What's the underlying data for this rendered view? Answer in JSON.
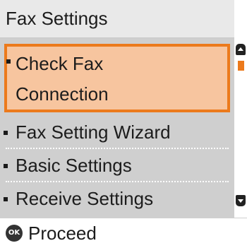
{
  "header": {
    "title": "Fax Settings"
  },
  "menu": {
    "selected": {
      "line1": "Check Fax",
      "line2": "Connection"
    },
    "items": [
      {
        "label": "Fax Setting Wizard"
      },
      {
        "label": "Basic Settings"
      },
      {
        "label": "Receive Settings"
      }
    ]
  },
  "footer": {
    "ok_glyph": "OK",
    "action": "Proceed"
  },
  "icons": {
    "ok": "ok-button-icon",
    "scroll_up": "scroll-up-icon",
    "scroll_down": "scroll-down-icon"
  },
  "colors": {
    "highlight_fill": "#f7c59f",
    "highlight_border": "#ec7a1c",
    "list_bg": "#cfcfcf",
    "title_bg": "#e9e9e9"
  }
}
